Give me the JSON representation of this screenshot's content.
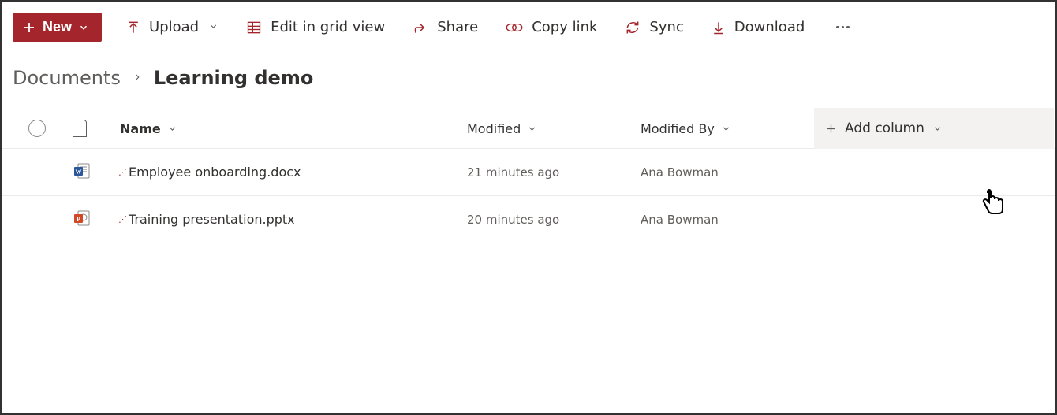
{
  "toolbar": {
    "new_label": "New",
    "upload_label": "Upload",
    "edit_grid_label": "Edit in grid view",
    "share_label": "Share",
    "copy_link_label": "Copy link",
    "sync_label": "Sync",
    "download_label": "Download"
  },
  "breadcrumb": {
    "root": "Documents",
    "current": "Learning demo"
  },
  "columns": {
    "name": "Name",
    "modified": "Modified",
    "modified_by": "Modified By",
    "add_column": "Add column"
  },
  "files": [
    {
      "type": "word",
      "name": "Employee onboarding.docx",
      "modified": "21 minutes ago",
      "modified_by": "Ana Bowman",
      "is_new": true
    },
    {
      "type": "powerpoint",
      "name": "Training presentation.pptx",
      "modified": "20 minutes ago",
      "modified_by": "Ana Bowman",
      "is_new": true
    }
  ]
}
